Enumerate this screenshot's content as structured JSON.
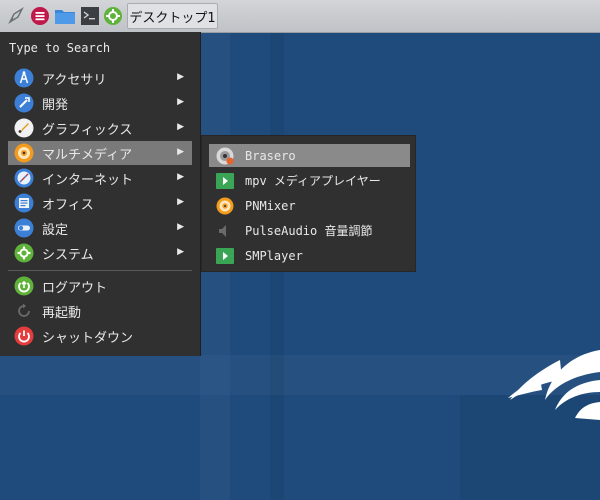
{
  "taskbar": {
    "desktop_button": "デスクトップ1",
    "launchers": [
      "rocket-icon",
      "app-menu-icon",
      "file-manager-icon",
      "terminal-icon",
      "settings-icon"
    ]
  },
  "menu": {
    "search_placeholder": "Type to Search",
    "items": [
      {
        "label": "アクセサリ",
        "icon": "accessories-icon",
        "submenu": true
      },
      {
        "label": "開発",
        "icon": "development-icon",
        "submenu": true
      },
      {
        "label": "グラフィックス",
        "icon": "graphics-icon",
        "submenu": true
      },
      {
        "label": "マルチメディア",
        "icon": "multimedia-icon",
        "submenu": true,
        "selected": true
      },
      {
        "label": "インターネット",
        "icon": "internet-icon",
        "submenu": true
      },
      {
        "label": "オフィス",
        "icon": "office-icon",
        "submenu": true
      },
      {
        "label": "設定",
        "icon": "preferences-icon",
        "submenu": true
      },
      {
        "label": "システム",
        "icon": "system-icon",
        "submenu": true
      }
    ],
    "session": [
      {
        "label": "ログアウト",
        "icon": "logout-icon"
      },
      {
        "label": "再起動",
        "icon": "reboot-icon"
      },
      {
        "label": "シャットダウン",
        "icon": "shutdown-icon"
      }
    ],
    "arrow": "▶"
  },
  "submenu": {
    "items": [
      {
        "label": "Brasero",
        "icon": "brasero-icon",
        "selected": true
      },
      {
        "label": "mpv メディアプレイヤー",
        "icon": "mpv-icon"
      },
      {
        "label": "PNMixer",
        "icon": "pnmixer-icon"
      },
      {
        "label": "PulseAudio 音量調節",
        "icon": "pulseaudio-icon"
      },
      {
        "label": "SMPlayer",
        "icon": "smplayer-icon"
      }
    ]
  },
  "colors": {
    "desktop": "#1e4b7c",
    "menu_bg": "#303030",
    "selection": "#7a7a7a",
    "taskbar": "#c9cbce"
  }
}
